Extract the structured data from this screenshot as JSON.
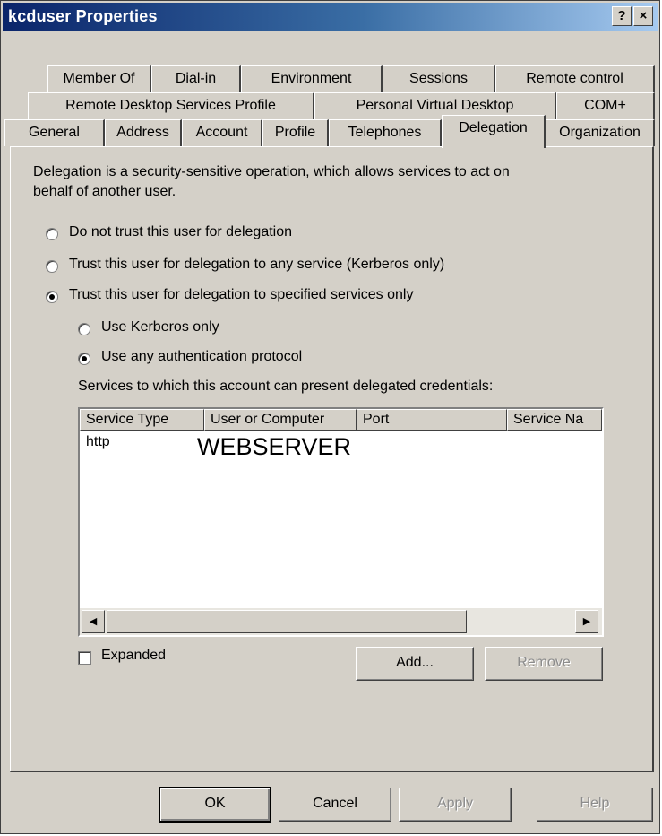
{
  "window": {
    "title": "kcduser Properties",
    "help_btn": "?",
    "close_btn": "×"
  },
  "tabs": {
    "row1": [
      "Member Of",
      "Dial-in",
      "Environment",
      "Sessions",
      "Remote control"
    ],
    "row2": [
      "Remote Desktop Services Profile",
      "Personal Virtual Desktop",
      "COM+"
    ],
    "row3": [
      "General",
      "Address",
      "Account",
      "Profile",
      "Telephones",
      "Delegation",
      "Organization"
    ],
    "active": "Delegation"
  },
  "delegation": {
    "description_line1": "Delegation is a security-sensitive operation, which allows services to act on",
    "description_line2": "behalf of another user.",
    "options": [
      {
        "label": "Do not trust this user for delegation",
        "selected": false
      },
      {
        "label": "Trust this user for delegation to any service (Kerberos only)",
        "selected": false
      },
      {
        "label": "Trust this user for delegation to specified services only",
        "selected": true
      }
    ],
    "sub_options": [
      {
        "label": "Use Kerberos only",
        "selected": false
      },
      {
        "label": "Use any authentication protocol",
        "selected": true
      }
    ],
    "services_label": "Services to which this account can present delegated credentials:",
    "columns": [
      "Service Type",
      "User or Computer",
      "Port",
      "Service Na"
    ],
    "rows": [
      {
        "service_type": "http",
        "user_or_computer": "WEBSERVER",
        "port": "",
        "service_name": ""
      }
    ],
    "expanded_label": "Expanded",
    "expanded_checked": false,
    "add_label": "Add...",
    "remove_label": "Remove"
  },
  "footer": {
    "ok": "OK",
    "cancel": "Cancel",
    "apply": "Apply",
    "help": "Help"
  },
  "colors": {
    "dialog_face": "#d4d0c8",
    "title_start": "#0a246a",
    "title_end": "#a6caf0",
    "disabled_text": "#8c8c8c"
  }
}
